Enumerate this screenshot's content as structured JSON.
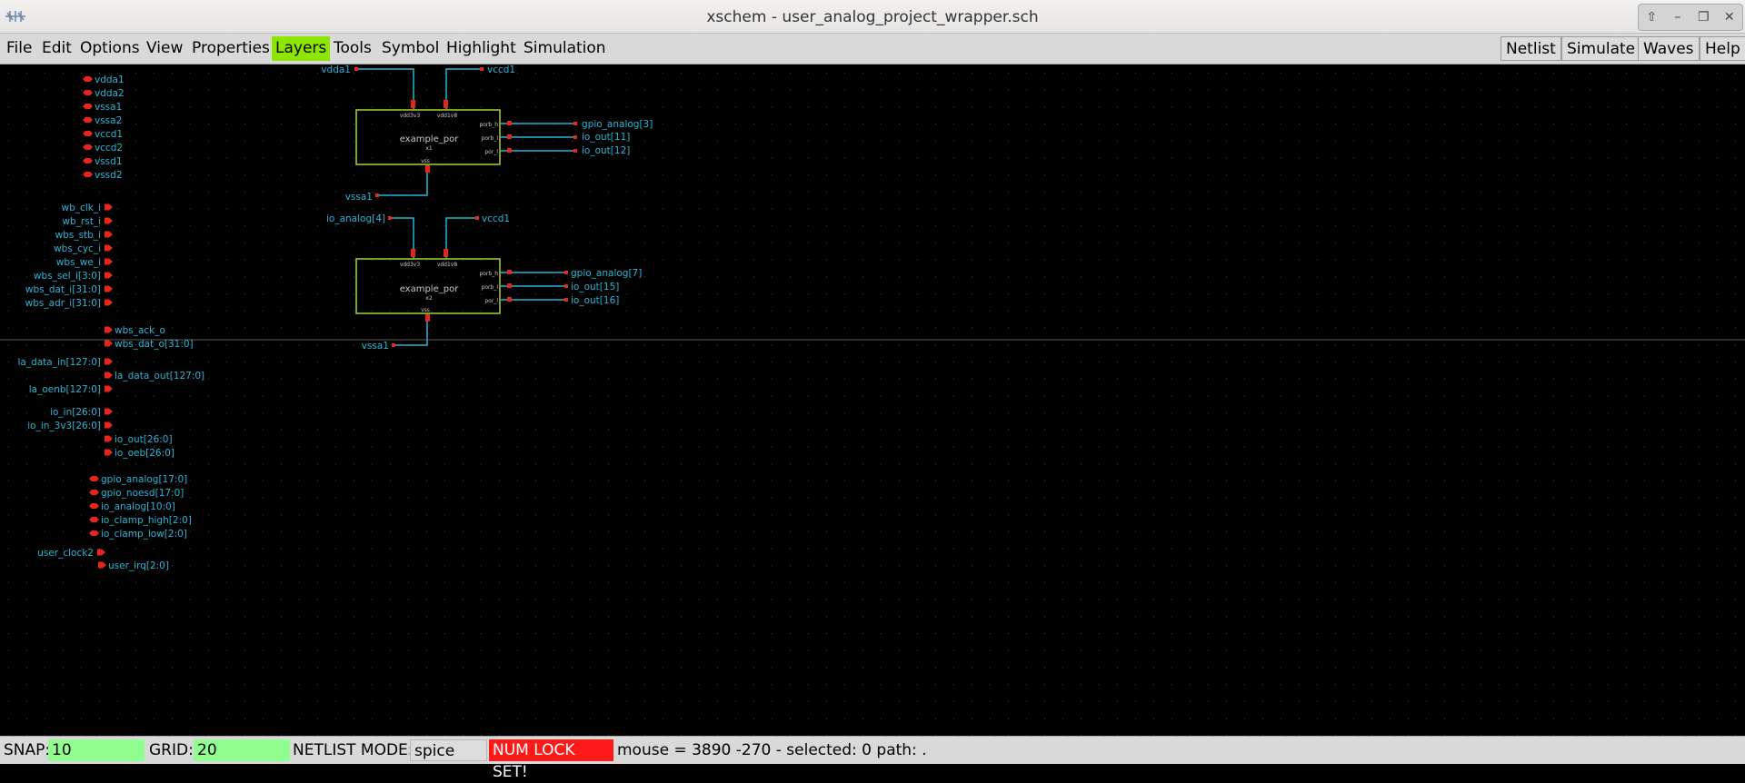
{
  "window": {
    "title": "xschem - user_analog_project_wrapper.sch"
  },
  "menu": [
    "File",
    "Edit",
    "Options",
    "View",
    "Properties",
    "Layers",
    "Tools",
    "Symbol",
    "Highlight",
    "Simulation"
  ],
  "active_menu": "Layers",
  "right_buttons": [
    "Netlist",
    "Simulate",
    "Waves",
    "Help"
  ],
  "colors": {
    "wire": "#2ab4d6",
    "pin": "#e8241c",
    "symbol_box": "#a6d632",
    "grid": "#444444",
    "active_menu": "#8ce600",
    "field": "#90ff90",
    "numlock": "#ff1a1a"
  },
  "status": {
    "snap_label": "SNAP:",
    "snap_value": "10",
    "grid_label": "GRID:",
    "grid_value": "20",
    "netlist_label": "NETLIST MODE:",
    "netlist_value": "spice",
    "numlock": "NUM LOCK SET!",
    "info": "mouse = 3890 -270 - selected: 0 path: ."
  },
  "schematic": {
    "io_pins": [
      {
        "name": "vdda1",
        "dir": "inout"
      },
      {
        "name": "vdda2",
        "dir": "inout"
      },
      {
        "name": "vssa1",
        "dir": "inout"
      },
      {
        "name": "vssa2",
        "dir": "inout"
      },
      {
        "name": "vccd1",
        "dir": "inout"
      },
      {
        "name": "vccd2",
        "dir": "inout"
      },
      {
        "name": "vssd1",
        "dir": "inout"
      },
      {
        "name": "vssd2",
        "dir": "inout"
      },
      {
        "name": "wb_clk_i",
        "dir": "input"
      },
      {
        "name": "wb_rst_i",
        "dir": "input"
      },
      {
        "name": "wbs_stb_i",
        "dir": "input"
      },
      {
        "name": "wbs_cyc_i",
        "dir": "input"
      },
      {
        "name": "wbs_we_i",
        "dir": "input"
      },
      {
        "name": "wbs_sel_i[3:0]",
        "dir": "input"
      },
      {
        "name": "wbs_dat_i[31:0]",
        "dir": "input"
      },
      {
        "name": "wbs_adr_i[31:0]",
        "dir": "input"
      },
      {
        "name": "wbs_ack_o",
        "dir": "output"
      },
      {
        "name": "wbs_dat_o[31:0]",
        "dir": "output"
      },
      {
        "name": "la_data_in[127:0]",
        "dir": "input"
      },
      {
        "name": "la_data_out[127:0]",
        "dir": "output"
      },
      {
        "name": "la_oenb[127:0]",
        "dir": "input"
      },
      {
        "name": "io_in[26:0]",
        "dir": "input"
      },
      {
        "name": "io_in_3v3[26:0]",
        "dir": "input"
      },
      {
        "name": "io_out[26:0]",
        "dir": "output"
      },
      {
        "name": "io_oeb[26:0]",
        "dir": "output"
      },
      {
        "name": "gpio_analog[17:0]",
        "dir": "inout"
      },
      {
        "name": "gpio_noesd[17:0]",
        "dir": "inout"
      },
      {
        "name": "io_analog[10:0]",
        "dir": "inout"
      },
      {
        "name": "io_clamp_high[2:0]",
        "dir": "inout"
      },
      {
        "name": "io_clamp_low[2:0]",
        "dir": "inout"
      },
      {
        "name": "user_clock2",
        "dir": "input"
      },
      {
        "name": "user_irq[2:0]",
        "dir": "output"
      }
    ],
    "instances": [
      {
        "symbol": "example_por",
        "instance": "x1",
        "pins": [
          "vdd3v3",
          "vdd1v8",
          "porb_h",
          "porb_l",
          "por_l",
          "vss"
        ],
        "nets": {
          "vdd3v3": "vdda1",
          "vdd1v8": "vccd1",
          "porb_h": "gpio_analog[3]",
          "porb_l": "io_out[11]",
          "por_l": "io_out[12]",
          "vss": "vssa1"
        }
      },
      {
        "symbol": "example_por",
        "instance": "x2",
        "pins": [
          "vdd3v3",
          "vdd1v8",
          "porb_h",
          "porb_l",
          "por_l",
          "vss"
        ],
        "nets": {
          "vdd3v3": "io_analog[4]",
          "vdd1v8": "vccd1",
          "porb_h": "gpio_analog[7]",
          "porb_l": "io_out[15]",
          "por_l": "io_out[16]",
          "vss": "vssa1"
        }
      }
    ]
  }
}
